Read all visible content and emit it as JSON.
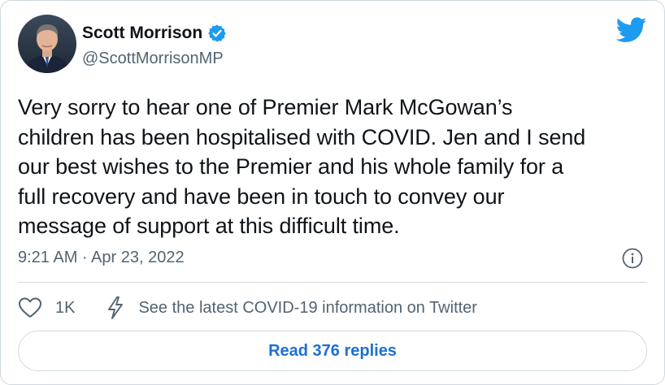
{
  "author": {
    "display_name": "Scott Morrison",
    "handle": "@ScottMorrisonMP",
    "verified": true
  },
  "tweet": {
    "text": "Very sorry to hear one of Premier Mark McGowan’s\nchildren has been hospitalised with COVID. Jen and I send\nour best wishes to the Premier and his whole family for a\nfull recovery and have been in touch to convey our\nmessage of support at this difficult time.",
    "timestamp": "9:21 AM · Apr 23, 2022"
  },
  "actions": {
    "like_count": "1K",
    "covid_info_label": "See the latest COVID-19 information on Twitter"
  },
  "replies_button": {
    "label": "Read 376 replies"
  },
  "icons": {
    "brand": "twitter-bird-icon",
    "verified": "verified-badge-icon",
    "info": "info-icon",
    "like": "heart-icon",
    "covid": "lightning-icon"
  },
  "colors": {
    "brand_blue": "#1d9bf0",
    "link_blue": "#1d6fd4",
    "text_primary": "#0f1419",
    "text_secondary": "#536471",
    "border": "#cfd9de"
  }
}
